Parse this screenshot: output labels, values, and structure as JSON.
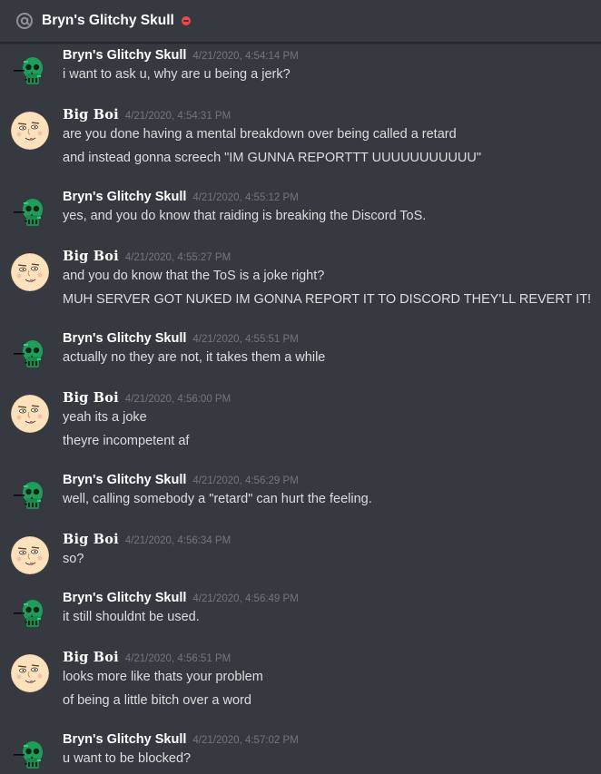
{
  "header": {
    "title": "Bryn's Glitchy Skull",
    "status": "dnd"
  },
  "colors": {
    "background": "#36393f",
    "username": "#ffffff",
    "timestamp": "#72767d",
    "text": "#dcddde",
    "dnd": "#f04747"
  },
  "messages": [
    {
      "author": "Bryn's Glitchy Skull",
      "avatar": "glitchy-skull",
      "timestamp": "4/21/2020, 4:54:14 PM",
      "lines": [
        "i want to ask u, why are u being a jerk?"
      ]
    },
    {
      "author": "Big Boi",
      "avatar": "big-boi-face",
      "timestamp": "4/21/2020, 4:54:31 PM",
      "lines": [
        "are you done having a mental breakdown over being called a retard",
        "and instead gonna screech \"IM GUNNA REPORTTT UUUUUUUUUUU\""
      ]
    },
    {
      "author": "Bryn's Glitchy Skull",
      "avatar": "glitchy-skull",
      "timestamp": "4/21/2020, 4:55:12 PM",
      "lines": [
        "yes, and you do know that raiding is breaking the Discord ToS."
      ]
    },
    {
      "author": "Big Boi",
      "avatar": "big-boi-face",
      "timestamp": "4/21/2020, 4:55:27 PM",
      "lines": [
        "and you do know that the ToS is a joke right?",
        "MUH SERVER GOT NUKED IM GONNA REPORT IT TO DISCORD THEY'LL REVERT IT!"
      ]
    },
    {
      "author": "Bryn's Glitchy Skull",
      "avatar": "glitchy-skull",
      "timestamp": "4/21/2020, 4:55:51 PM",
      "lines": [
        "actually no they are not, it takes them a while"
      ]
    },
    {
      "author": "Big Boi",
      "avatar": "big-boi-face",
      "timestamp": "4/21/2020, 4:56:00 PM",
      "lines": [
        "yeah its a joke",
        "theyre incompetent af"
      ]
    },
    {
      "author": "Bryn's Glitchy Skull",
      "avatar": "glitchy-skull",
      "timestamp": "4/21/2020, 4:56:29 PM",
      "lines": [
        "well, calling somebody a \"retard\" can hurt the feeling."
      ]
    },
    {
      "author": "Big Boi",
      "avatar": "big-boi-face",
      "timestamp": "4/21/2020, 4:56:34 PM",
      "lines": [
        "so?"
      ]
    },
    {
      "author": "Bryn's Glitchy Skull",
      "avatar": "glitchy-skull",
      "timestamp": "4/21/2020, 4:56:49 PM",
      "lines": [
        "it still shouldnt be used."
      ]
    },
    {
      "author": "Big Boi",
      "avatar": "big-boi-face",
      "timestamp": "4/21/2020, 4:56:51 PM",
      "lines": [
        "looks more like thats your problem",
        "of being a little bitch over a word"
      ]
    },
    {
      "author": "Bryn's Glitchy Skull",
      "avatar": "glitchy-skull",
      "timestamp": "4/21/2020, 4:57:02 PM",
      "lines": [
        "u want to be blocked?"
      ]
    }
  ]
}
